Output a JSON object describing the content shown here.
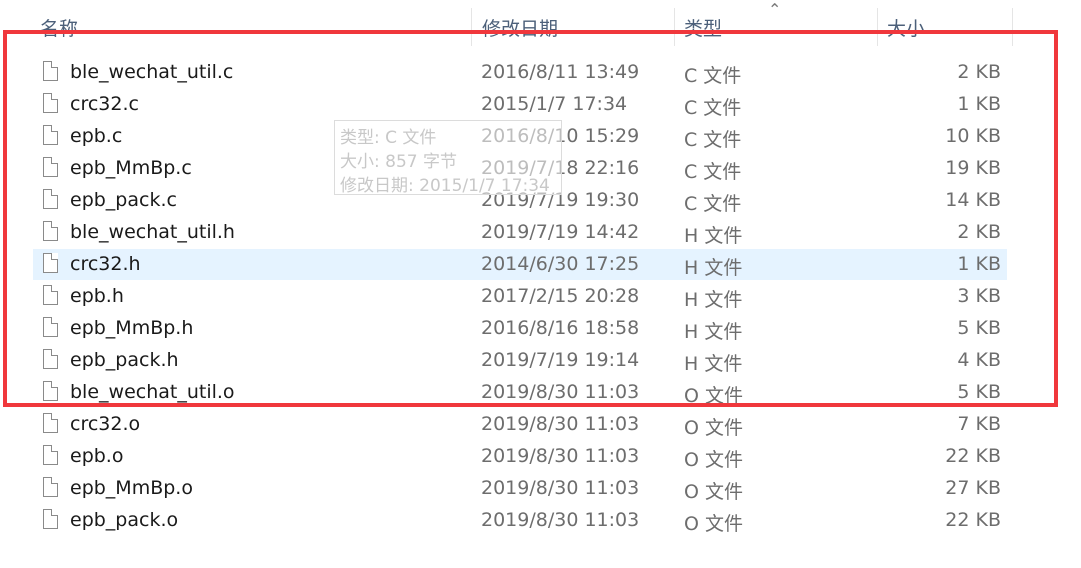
{
  "columns": {
    "name": "名称",
    "date": "修改日期",
    "type": "类型",
    "size": "大小"
  },
  "files": [
    {
      "name": "ble_wechat_util.c",
      "date": "2016/8/11 13:49",
      "type": "C 文件",
      "size": "2 KB"
    },
    {
      "name": "crc32.c",
      "date": "2015/1/7 17:34",
      "type": "C 文件",
      "size": "1 KB"
    },
    {
      "name": "epb.c",
      "date": "2016/8/10 15:29",
      "type": "C 文件",
      "size": "10 KB"
    },
    {
      "name": "epb_MmBp.c",
      "date": "2019/7/18 22:16",
      "type": "C 文件",
      "size": "19 KB"
    },
    {
      "name": "epb_pack.c",
      "date": "2019/7/19 19:30",
      "type": "C 文件",
      "size": "14 KB"
    },
    {
      "name": "ble_wechat_util.h",
      "date": "2019/7/19 14:42",
      "type": "H 文件",
      "size": "2 KB"
    },
    {
      "name": "crc32.h",
      "date": "2014/6/30 17:25",
      "type": "H 文件",
      "size": "1 KB"
    },
    {
      "name": "epb.h",
      "date": "2017/2/15 20:28",
      "type": "H 文件",
      "size": "3 KB"
    },
    {
      "name": "epb_MmBp.h",
      "date": "2016/8/16 18:58",
      "type": "H 文件",
      "size": "5 KB"
    },
    {
      "name": "epb_pack.h",
      "date": "2019/7/19 19:14",
      "type": "H 文件",
      "size": "4 KB"
    },
    {
      "name": "ble_wechat_util.o",
      "date": "2019/8/30 11:03",
      "type": "O 文件",
      "size": "5 KB"
    },
    {
      "name": "crc32.o",
      "date": "2019/8/30 11:03",
      "type": "O 文件",
      "size": "7 KB"
    },
    {
      "name": "epb.o",
      "date": "2019/8/30 11:03",
      "type": "O 文件",
      "size": "22 KB"
    },
    {
      "name": "epb_MmBp.o",
      "date": "2019/8/30 11:03",
      "type": "O 文件",
      "size": "27 KB"
    },
    {
      "name": "epb_pack.o",
      "date": "2019/8/30 11:03",
      "type": "O 文件",
      "size": "22 KB"
    }
  ],
  "hovered_row": 6,
  "tooltip": {
    "type_line": "类型: C 文件",
    "size_line": "大小: 857 字节",
    "date_line": "修改日期: 2015/1/7 17:34"
  },
  "highlight_color": "#f0373c",
  "hover_color": "#e5f3ff",
  "sort_indicator_icon": "chevron-up-icon",
  "file_icon": "document-icon"
}
